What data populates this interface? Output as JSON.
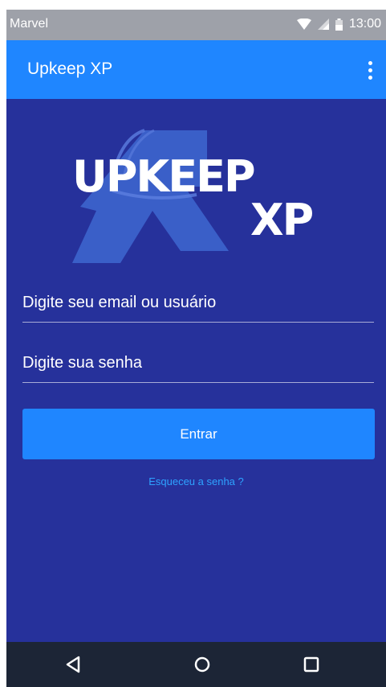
{
  "status_bar": {
    "carrier": "Marvel",
    "time": "13:00",
    "icons": [
      "wifi-icon",
      "signal-icon",
      "battery-icon"
    ]
  },
  "app_bar": {
    "title": "Upkeep XP",
    "menu_icon": "more-vert-icon"
  },
  "logo": {
    "line1": "UPKEEP",
    "line2": "XP"
  },
  "form": {
    "email_placeholder": "Digite seu email ou usuário",
    "password_placeholder": "Digite sua senha",
    "submit_label": "Entrar",
    "forgot_label": "Esqueceu a senha ?"
  },
  "nav_bar": {
    "icons": [
      "back-icon",
      "home-icon",
      "recent-apps-icon"
    ]
  },
  "colors": {
    "background": "#26319b",
    "primary": "#1f86ff",
    "link": "#2ea3ff",
    "status_bar": "#9ea1a9",
    "nav_bar": "#1c2536"
  }
}
